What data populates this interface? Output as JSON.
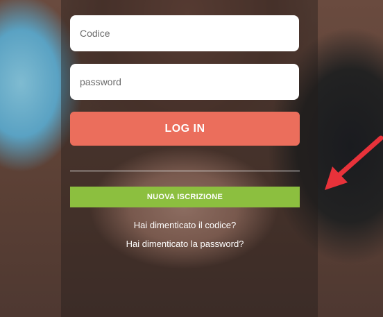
{
  "login_form": {
    "code_placeholder": "Codice",
    "password_placeholder": "password",
    "login_label": "LOG IN",
    "signup_label": "NUOVA ISCRIZIONE",
    "forgot_code_label": "Hai dimenticato il codice?",
    "forgot_password_label": "Hai dimenticato la password?"
  },
  "colors": {
    "login_button": "#eb6e5c",
    "signup_button": "#8cbf3f",
    "annotation_arrow": "#e8323a"
  }
}
